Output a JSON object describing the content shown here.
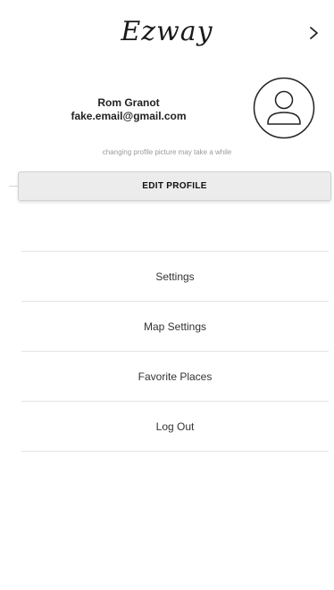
{
  "header": {
    "app_title": "Ezway",
    "forward_icon": "chevron-right-icon"
  },
  "profile": {
    "name": "Rom Granot",
    "email": "fake.email@gmail.com",
    "avatar_icon": "user-avatar-icon",
    "picture_hint": "changing profile picture may take a while",
    "edit_button_label": "EDIT PROFILE"
  },
  "menu": {
    "items": [
      {
        "label": "Settings"
      },
      {
        "label": "Map Settings"
      },
      {
        "label": "Favorite Places"
      },
      {
        "label": "Log Out"
      }
    ]
  },
  "colors": {
    "background": "#ffffff",
    "button_background": "#ececec",
    "divider": "#e3e3e3",
    "hint_text": "#9a9a9a"
  }
}
